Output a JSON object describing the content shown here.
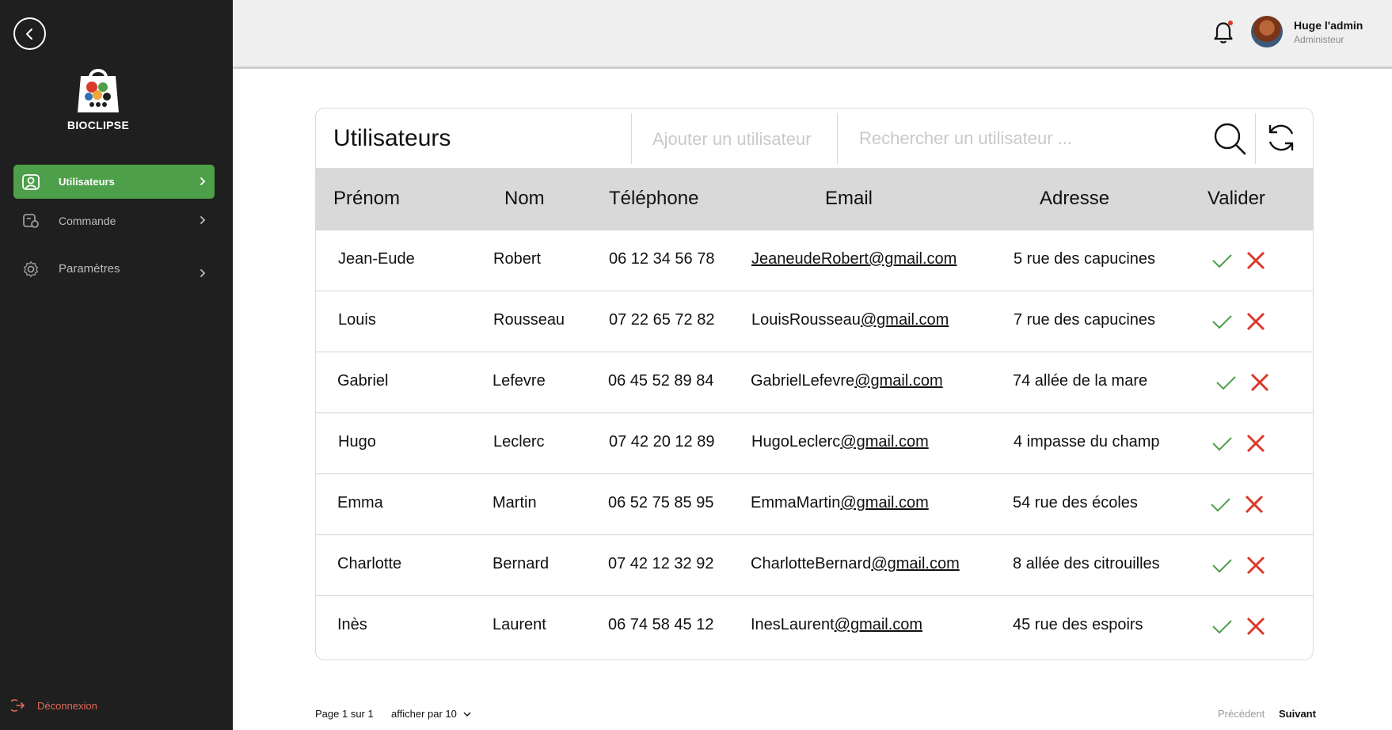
{
  "brand": {
    "name": "BIOCLIPSE"
  },
  "sidebar": {
    "items": [
      {
        "label": "Utilisateurs",
        "icon": "user-card-icon",
        "active": true
      },
      {
        "label": "Commande",
        "icon": "order-icon",
        "active": false
      },
      {
        "label": "Paramètres",
        "icon": "gear-icon",
        "active": false
      }
    ],
    "logout_label": "Déconnexion"
  },
  "topbar": {
    "user_name": "Huge l'admin",
    "user_role": "Administeur"
  },
  "card": {
    "title": "Utilisateurs",
    "add_user_label": "Ajouter un utilisateur",
    "search_placeholder": "Rechercher un utilisateur ..."
  },
  "table": {
    "columns": [
      "Prénom",
      "Nom",
      "Téléphone",
      "Email",
      "Adresse",
      "Valider"
    ],
    "rows": [
      {
        "prenom": "Jean-Eude",
        "nom": "Robert",
        "tel": "06 12 34 56 78",
        "email_user": "JeaneudeRobert@gmail.com",
        "email_domain": "",
        "adresse": "5 rue des capucines"
      },
      {
        "prenom": "Louis",
        "nom": "Rousseau",
        "tel": "07 22 65 72 82",
        "email_user": "LouisRousseau",
        "email_domain": "@gmail.com",
        "adresse": "7 rue des capucines"
      },
      {
        "prenom": "Gabriel",
        "nom": "Lefevre",
        "tel": "06 45 52 89 84",
        "email_user": "GabrielLefevre",
        "email_domain": "@gmail.com",
        "adresse": "74 allée de la mare"
      },
      {
        "prenom": "Hugo",
        "nom": "Leclerc",
        "tel": "07 42 20 12 89",
        "email_user": "HugoLeclerc",
        "email_domain": "@gmail.com",
        "adresse": "4 impasse du champ"
      },
      {
        "prenom": "Emma",
        "nom": "Martin",
        "tel": "06 52 75 85 95",
        "email_user": "EmmaMartin",
        "email_domain": "@gmail.com",
        "adresse": "54 rue des écoles"
      },
      {
        "prenom": "Charlotte",
        "nom": "Bernard",
        "tel": "07 42 12 32 92",
        "email_user": "CharlotteBernard",
        "email_domain": "@gmail.com",
        "adresse": "8 allée des citrouilles"
      },
      {
        "prenom": "Inès",
        "nom": "Laurent",
        "tel": "06 74 58 45 12",
        "email_user": "InesLaurent",
        "email_domain": "@gmail.com",
        "adresse": "45 rue des espoirs"
      }
    ]
  },
  "pagination": {
    "page_label": "Page 1 sur 1",
    "per_page_label": "afficher par 10",
    "prev_label": "Précédent",
    "next_label": "Suivant"
  },
  "colors": {
    "sidebar_bg": "#1f1f1f",
    "accent_green": "#4e9f4a",
    "reject_red": "#d93a2b",
    "logout_red": "#e26a5a"
  }
}
